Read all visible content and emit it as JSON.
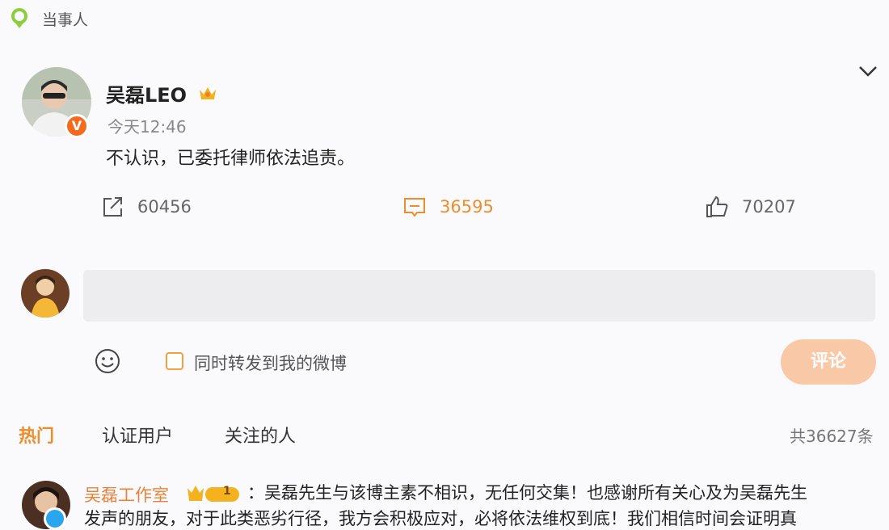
{
  "tag": {
    "label": "当事人",
    "icon": "location-pin-icon"
  },
  "post": {
    "author": "吴磊LEO",
    "timestamp": "今天12:46",
    "text": "不认识，已委托律师依法追责。",
    "actions": {
      "repost_count": "60456",
      "comment_count": "36595",
      "like_count": "70207"
    }
  },
  "composer": {
    "placeholder": "",
    "repost_label": "同时转发到我的微博",
    "submit_label": "评论"
  },
  "tabs": {
    "hot": "热门",
    "verified": "认证用户",
    "following": "关注的人",
    "total": "共36627条"
  },
  "comments": [
    {
      "author": "吴磊工作室",
      "badge": "1",
      "text_line1": "：吴磊先生与该博主素不相识，无任何交集！也感谢所有关心及为吴磊先生",
      "text_line2": "发声的朋友，对于此类恶劣行径，我方会积极应对，必将依法维权到底！我们相信时间会证明真"
    }
  ],
  "colors": {
    "accent": "#f08d2a",
    "submit_disabled": "#f9c8a6",
    "verified_orange": "#f46b1e",
    "verified_blue": "#2aa6ef"
  }
}
